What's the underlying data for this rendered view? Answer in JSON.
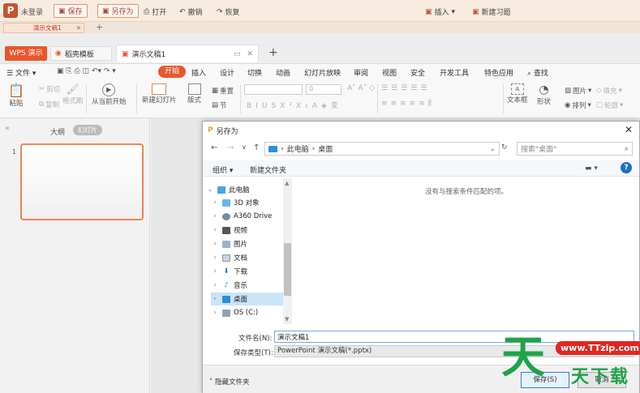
{
  "top_bar": {
    "login": "未登录",
    "save": "保存",
    "save_as": "另存为",
    "print": "打开",
    "undo": "撤销",
    "redo": "恢复",
    "insert": "插入",
    "new_question": "新建习题"
  },
  "mini_tab": {
    "label": "演示文稿1"
  },
  "tabs": {
    "wps": "WPS 演示",
    "template": "稻壳模板",
    "doc": "演示文稿1"
  },
  "menu": {
    "file": "文件",
    "start": "开始",
    "items": [
      "插入",
      "设计",
      "切换",
      "动画",
      "幻灯片放映",
      "审阅",
      "视图",
      "安全",
      "开发工具",
      "特色应用"
    ],
    "search": "查找"
  },
  "ribbon": {
    "paste": "粘贴",
    "cut": "剪切",
    "copy": "复制",
    "format_painter": "格式刷",
    "play_from_current": "从当前开始",
    "new_slide": "新建幻灯片",
    "layout": "版式",
    "section": "节",
    "reset": "重置",
    "font_size": "0",
    "text_box": "文本框",
    "shape": "形状",
    "picture": "图片",
    "arrange": "排列",
    "fill": "填充",
    "outline": "轮廓"
  },
  "left_panel": {
    "outline_tab": "大纲",
    "slides_tab": "幻灯片",
    "slide_number": "1"
  },
  "dialog": {
    "title": "另存为",
    "path": [
      "此电脑",
      "桌面"
    ],
    "search_placeholder": "搜索\"桌面\"",
    "organize": "组织",
    "new_folder": "新建文件夹",
    "tree": [
      {
        "label": "此电脑",
        "icon": "computer-icon",
        "level": 0
      },
      {
        "label": "3D 对象",
        "icon": "3d-objects-icon",
        "level": 1
      },
      {
        "label": "A360 Drive",
        "icon": "drive-icon",
        "level": 1
      },
      {
        "label": "视频",
        "icon": "video-icon",
        "level": 1
      },
      {
        "label": "图片",
        "icon": "pictures-icon",
        "level": 1
      },
      {
        "label": "文档",
        "icon": "documents-icon",
        "level": 1
      },
      {
        "label": "下载",
        "icon": "downloads-icon",
        "level": 1
      },
      {
        "label": "音乐",
        "icon": "music-icon",
        "level": 1
      },
      {
        "label": "桌面",
        "icon": "desktop-icon",
        "level": 1
      },
      {
        "label": "OS (C:)",
        "icon": "disk-icon",
        "level": 1
      }
    ],
    "empty_message": "没有与搜索条件匹配的项。",
    "filename_label": "文件名(N):",
    "filename_value": "演示文稿1",
    "filetype_label": "保存类型(T):",
    "filetype_value": "PowerPoint 演示文稿(*.pptx)",
    "hide_folders": "隐藏文件夹",
    "save_button": "保存(S)",
    "cancel_button": "取消"
  },
  "watermark": {
    "glyph": "天",
    "url": "www.TTzip.com",
    "text": "天下载"
  },
  "colors": {
    "accent": "#e9572b",
    "selection": "#cce4f7",
    "watermark_green": "#1fa34a",
    "watermark_red": "#e2261f"
  }
}
